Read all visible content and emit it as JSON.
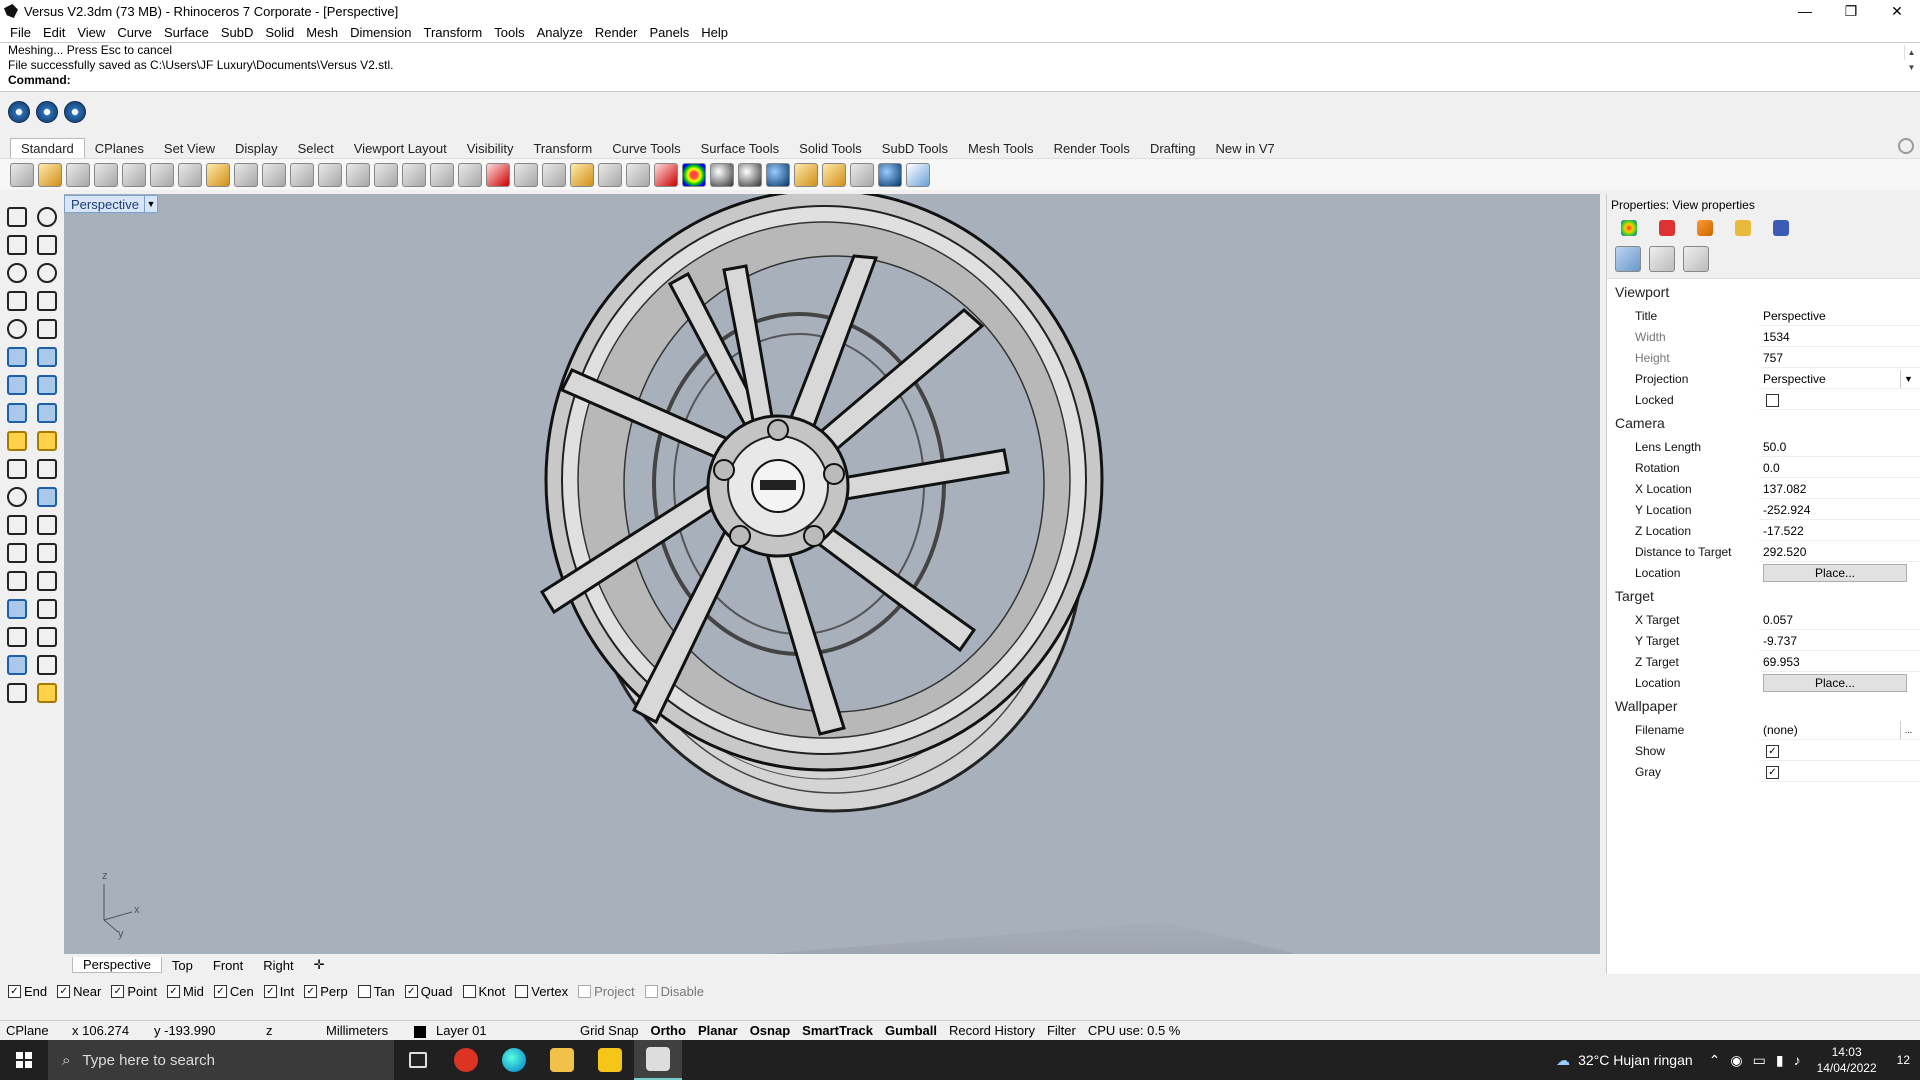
{
  "window": {
    "title": "Versus V2.3dm (73 MB) - Rhinoceros 7 Corporate - [Perspective]",
    "minimize": "—",
    "restore": "❐",
    "close": "✕"
  },
  "menu": [
    "File",
    "Edit",
    "View",
    "Curve",
    "Surface",
    "SubD",
    "Solid",
    "Mesh",
    "Dimension",
    "Transform",
    "Tools",
    "Analyze",
    "Render",
    "Panels",
    "Help"
  ],
  "command": {
    "line1": "Meshing... Press Esc to cancel",
    "line2": "File successfully saved as C:\\Users\\JF Luxury\\Documents\\Versus V2.stl.",
    "prompt": "Command:"
  },
  "toolbar_tabs": [
    "Standard",
    "CPlanes",
    "Set View",
    "Display",
    "Select",
    "Viewport Layout",
    "Visibility",
    "Transform",
    "Curve Tools",
    "Surface Tools",
    "Solid Tools",
    "SubD Tools",
    "Mesh Tools",
    "Render Tools",
    "Drafting",
    "New in V7"
  ],
  "viewport": {
    "title": "Perspective",
    "axis_z": "z",
    "axis_x": "x",
    "axis_y": "y"
  },
  "viewport_tabs": [
    "Perspective",
    "Top",
    "Front",
    "Right"
  ],
  "properties": {
    "header": "Properties: View properties",
    "viewport_section": "Viewport",
    "title_label": "Title",
    "title_value": "Perspective",
    "width_label": "Width",
    "width_value": "1534",
    "height_label": "Height",
    "height_value": "757",
    "projection_label": "Projection",
    "projection_value": "Perspective",
    "locked_label": "Locked",
    "camera_section": "Camera",
    "lens_label": "Lens Length",
    "lens_value": "50.0",
    "rotation_label": "Rotation",
    "rotation_value": "0.0",
    "xloc_label": "X Location",
    "xloc_value": "137.082",
    "yloc_label": "Y Location",
    "yloc_value": "-252.924",
    "zloc_label": "Z Location",
    "zloc_value": "-17.522",
    "dist_label": "Distance to Target",
    "dist_value": "292.520",
    "cam_location_label": "Location",
    "place_button": "Place...",
    "target_section": "Target",
    "xt_label": "X Target",
    "xt_value": "0.057",
    "yt_label": "Y Target",
    "yt_value": "-9.737",
    "zt_label": "Z Target",
    "zt_value": "69.953",
    "tgt_location_label": "Location",
    "wallpaper_section": "Wallpaper",
    "filename_label": "Filename",
    "filename_value": "(none)",
    "browse": "...",
    "show_label": "Show",
    "gray_label": "Gray"
  },
  "osnaps": [
    {
      "label": "End",
      "checked": true
    },
    {
      "label": "Near",
      "checked": true
    },
    {
      "label": "Point",
      "checked": true
    },
    {
      "label": "Mid",
      "checked": true
    },
    {
      "label": "Cen",
      "checked": true
    },
    {
      "label": "Int",
      "checked": true
    },
    {
      "label": "Perp",
      "checked": true
    },
    {
      "label": "Tan",
      "checked": false
    },
    {
      "label": "Quad",
      "checked": true
    },
    {
      "label": "Knot",
      "checked": false
    },
    {
      "label": "Vertex",
      "checked": false
    },
    {
      "label": "Project",
      "checked": false,
      "disabled": true
    },
    {
      "label": "Disable",
      "checked": false,
      "disabled": true
    }
  ],
  "status": {
    "cplane": "CPlane",
    "x": "x 106.274",
    "y": "y -193.990",
    "z": "z",
    "units": "Millimeters",
    "layer": "Layer 01",
    "grid_snap": "Grid Snap",
    "ortho": "Ortho",
    "planar": "Planar",
    "osnap": "Osnap",
    "smarttrack": "SmartTrack",
    "gumball": "Gumball",
    "record_history": "Record History",
    "filter": "Filter",
    "cpu": "CPU use: 0.5 %"
  },
  "taskbar": {
    "search_placeholder": "Type here to search",
    "weather": "32°C  Hujan ringan",
    "time": "14:03",
    "date": "14/04/2022",
    "notif": "12"
  }
}
